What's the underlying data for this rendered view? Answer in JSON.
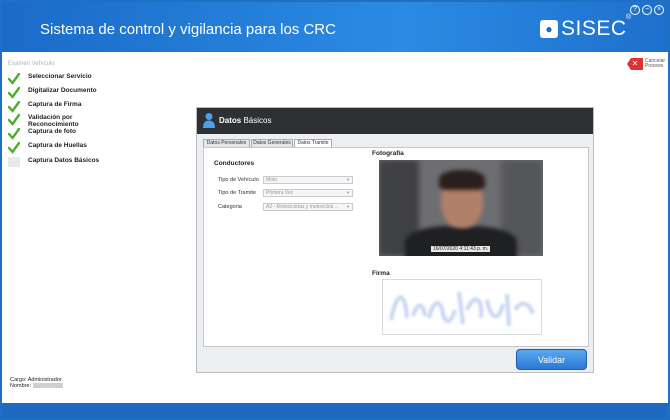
{
  "header": {
    "title": "Sistema de control y vigilancia para los CRC",
    "logo_badge": "●",
    "logo_text": "SISEC",
    "logo_mark": "®"
  },
  "window_controls": {
    "help": "?",
    "minimize": "−",
    "close": "×"
  },
  "sidebar": {
    "title": "Examen Vehículo",
    "steps": [
      {
        "label": "Seleccionar Servicio",
        "done": true
      },
      {
        "label": "Digitalizar Documento",
        "done": true
      },
      {
        "label": "Captura de Firma",
        "done": true
      },
      {
        "label": "Validación por Reconocimiento",
        "done": true
      },
      {
        "label": "Captura de foto",
        "done": true
      },
      {
        "label": "Captura de Huellas",
        "done": true
      },
      {
        "label": "Captura Datos Básicos",
        "done": false
      }
    ]
  },
  "cancel": {
    "icon_glyph": "✕",
    "label": "Cancelar Proceso"
  },
  "user": {
    "cargo": "Cargo: Administrador",
    "nombre_label": "Nombre:"
  },
  "panel": {
    "title_bold": "Datos",
    "title_rest": "Básicos",
    "tabs": [
      "Datos Personales",
      "Datos Generales",
      "Datos Tramite"
    ],
    "active_tab": 2,
    "section_title": "Conductores",
    "fields": [
      {
        "label": "Tipo de Vehículo",
        "value": "Moto"
      },
      {
        "label": "Tipo de Tramite",
        "value": "Primera Vez"
      },
      {
        "label": "Categoria",
        "value": "A2 - Motocicletas y motociclos ..."
      }
    ],
    "photo_title": "Fotografía",
    "photo_stamp": "16/07/2020 4:11:43 p. m.",
    "signature_title": "Firma"
  },
  "validate_button": "Validar",
  "colors": {
    "header_blue": "#1a6bc7",
    "check_green": "#4caf2a",
    "panel_header": "#2e3033",
    "cancel_red": "#d33333"
  }
}
